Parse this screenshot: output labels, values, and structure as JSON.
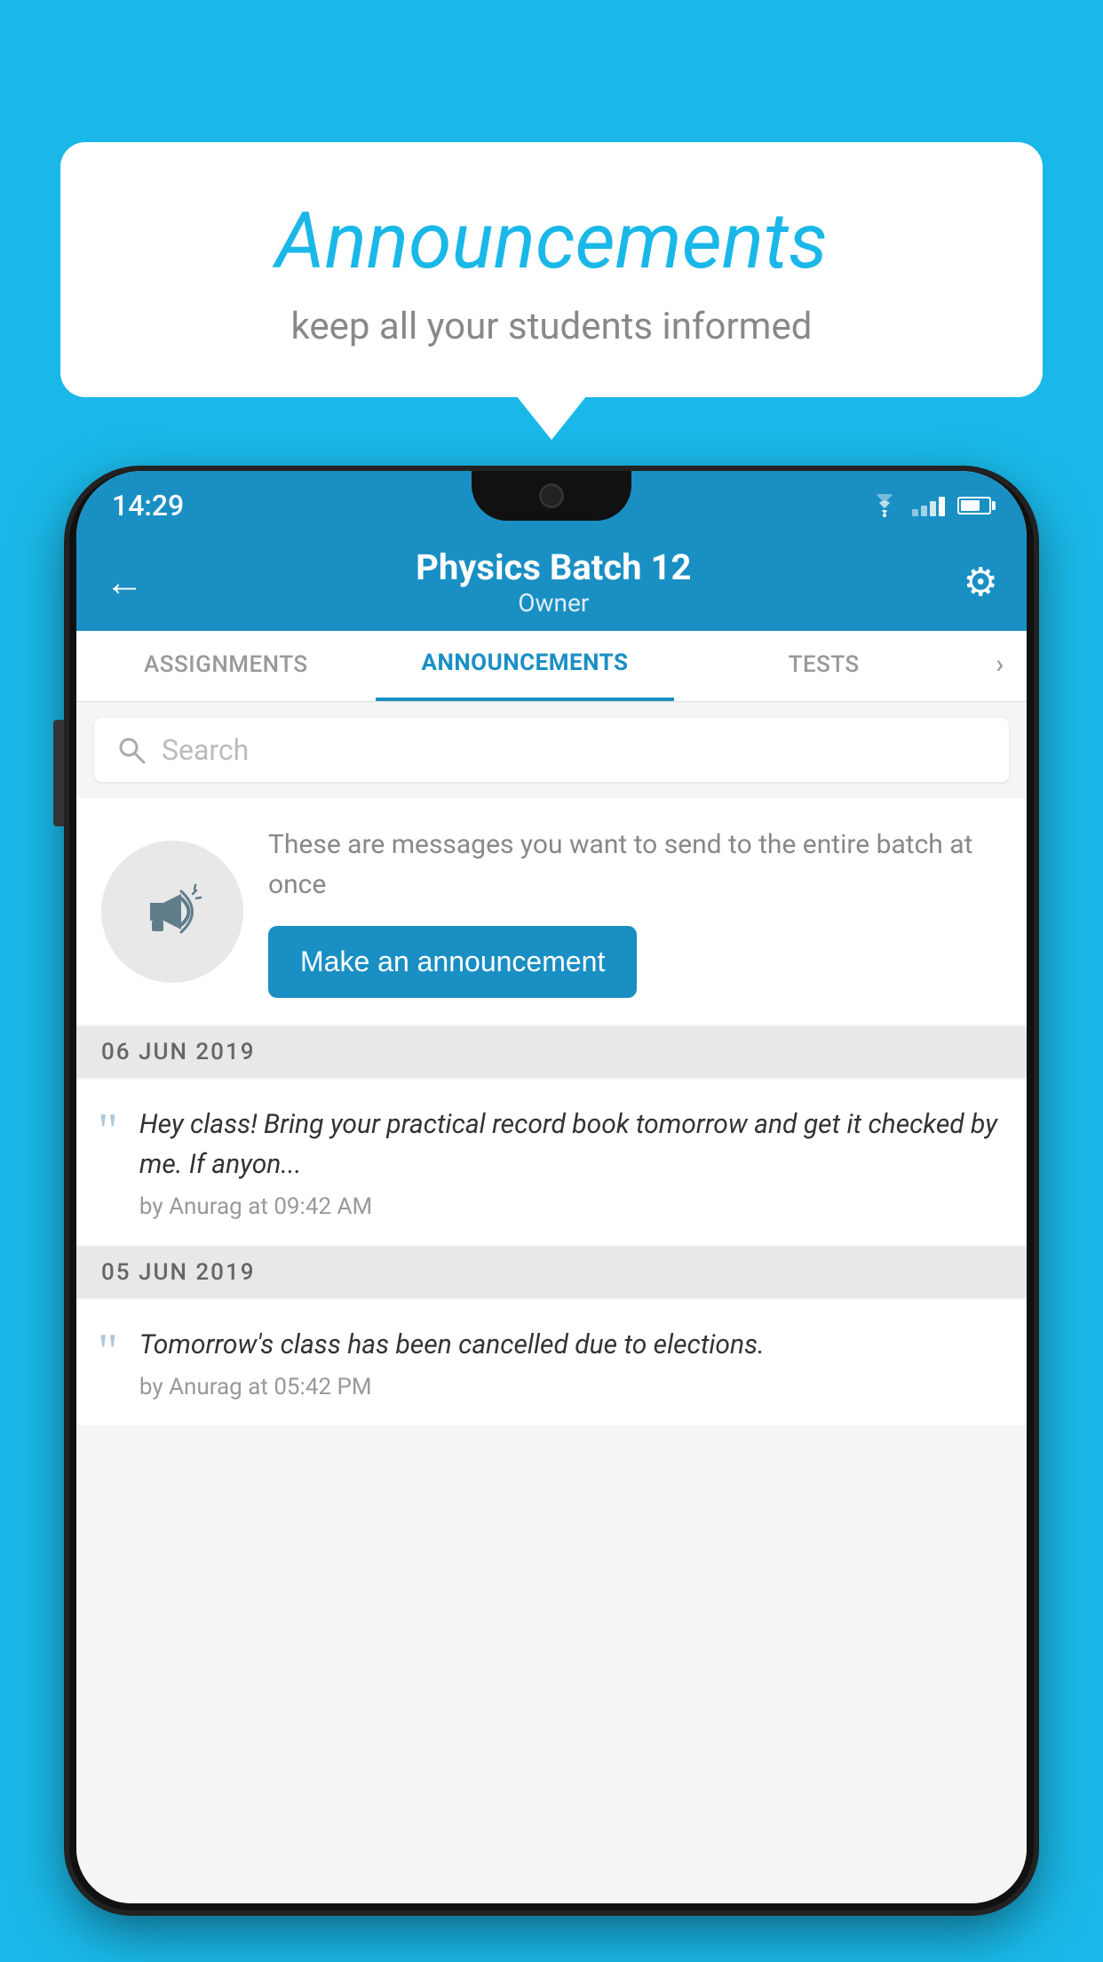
{
  "background_color": "#1ab8e8",
  "speech_bubble": {
    "title": "Announcements",
    "subtitle": "keep all your students informed"
  },
  "status_bar": {
    "time": "14:29"
  },
  "app_header": {
    "title": "Physics Batch 12",
    "subtitle": "Owner",
    "back_label": "←",
    "settings_label": "⚙"
  },
  "tabs": [
    {
      "label": "ASSIGNMENTS",
      "active": false
    },
    {
      "label": "ANNOUNCEMENTS",
      "active": true
    },
    {
      "label": "TESTS",
      "active": false
    }
  ],
  "search": {
    "placeholder": "Search"
  },
  "empty_state": {
    "info_text": "These are messages you want to send to the entire batch at once",
    "button_label": "Make an announcement"
  },
  "date_groups": [
    {
      "date": "06  JUN  2019",
      "items": [
        {
          "text": "Hey class! Bring your practical record book tomorrow and get it checked by me. If anyon...",
          "meta": "by Anurag at 09:42 AM"
        }
      ]
    },
    {
      "date": "05  JUN  2019",
      "items": [
        {
          "text": "Tomorrow's class has been cancelled due to elections.",
          "meta": "by Anurag at 05:42 PM"
        }
      ]
    }
  ]
}
